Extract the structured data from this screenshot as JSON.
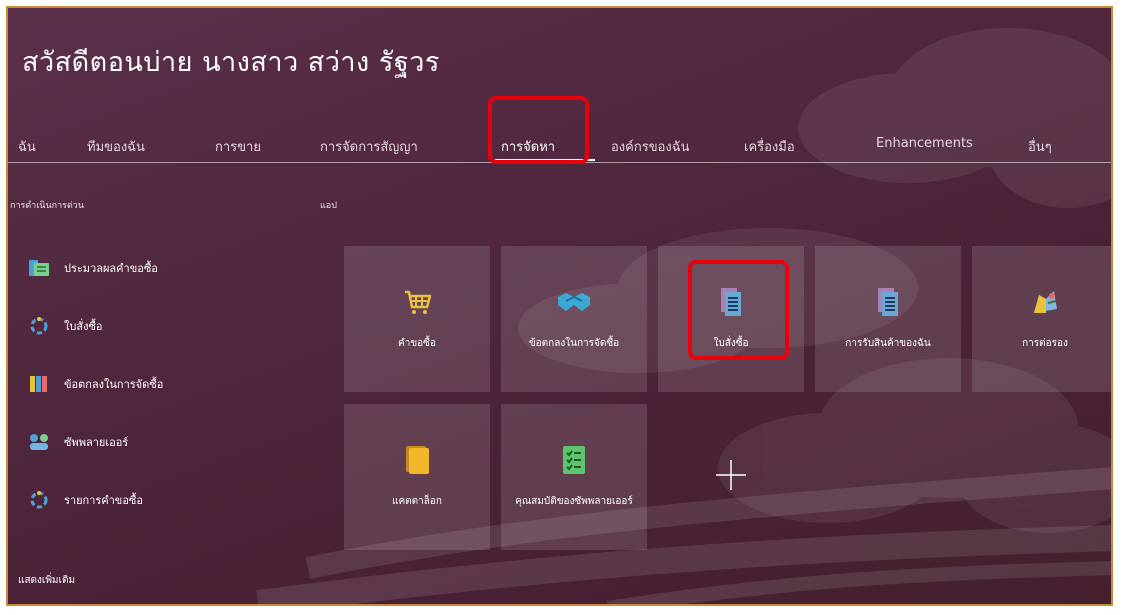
{
  "header": {
    "greeting": "สวัสดีตอนบ่าย นางสาว สว่าง รัฐวร"
  },
  "nav": {
    "tabs": [
      {
        "label": "ฉัน"
      },
      {
        "label": "ทีมของฉัน"
      },
      {
        "label": "การขาย"
      },
      {
        "label": "การจัดการสัญญา"
      },
      {
        "label": "การจัดหา",
        "active": true
      },
      {
        "label": "องค์กรของฉัน"
      },
      {
        "label": "เครื่องมือ"
      },
      {
        "label": "Enhancements"
      },
      {
        "label": "อื่นๆ"
      }
    ]
  },
  "quick_actions": {
    "title": "การดำเนินการด่วน",
    "items": [
      {
        "label": "ประมวลผลคำขอซื้อ",
        "icon": "process-requisition-icon"
      },
      {
        "label": "ใบสั่งซื้อ",
        "icon": "purchase-order-icon"
      },
      {
        "label": "ข้อตกลงในการจัดซื้อ",
        "icon": "purchase-agreement-icon"
      },
      {
        "label": "ซัพพลายเออร์",
        "icon": "supplier-icon"
      },
      {
        "label": "รายการคำขอซื้อ",
        "icon": "requisition-list-icon"
      }
    ],
    "more_label": "แสดงเพิ่มเติม"
  },
  "apps": {
    "title": "แอป",
    "tiles": [
      {
        "label": "คำขอซื้อ",
        "icon": "cart-icon"
      },
      {
        "label": "ข้อตกลงในการจัดซื้อ",
        "icon": "handshake-icon"
      },
      {
        "label": "ใบสั่งซื้อ",
        "icon": "document-icon"
      },
      {
        "label": "การรับสินค้าของฉัน",
        "icon": "document-icon"
      },
      {
        "label": "การต่อรอง",
        "icon": "negotiation-icon"
      },
      {
        "label": "แคตตาล็อก",
        "icon": "catalog-icon"
      },
      {
        "label": "คุณสมบัติของซัพพลายเออร์",
        "icon": "checklist-icon"
      }
    ],
    "add_icon": "plus-icon"
  },
  "colors": {
    "background": "#4f2840",
    "highlight": "#e8000b",
    "frame_border": "#c98a3a"
  }
}
